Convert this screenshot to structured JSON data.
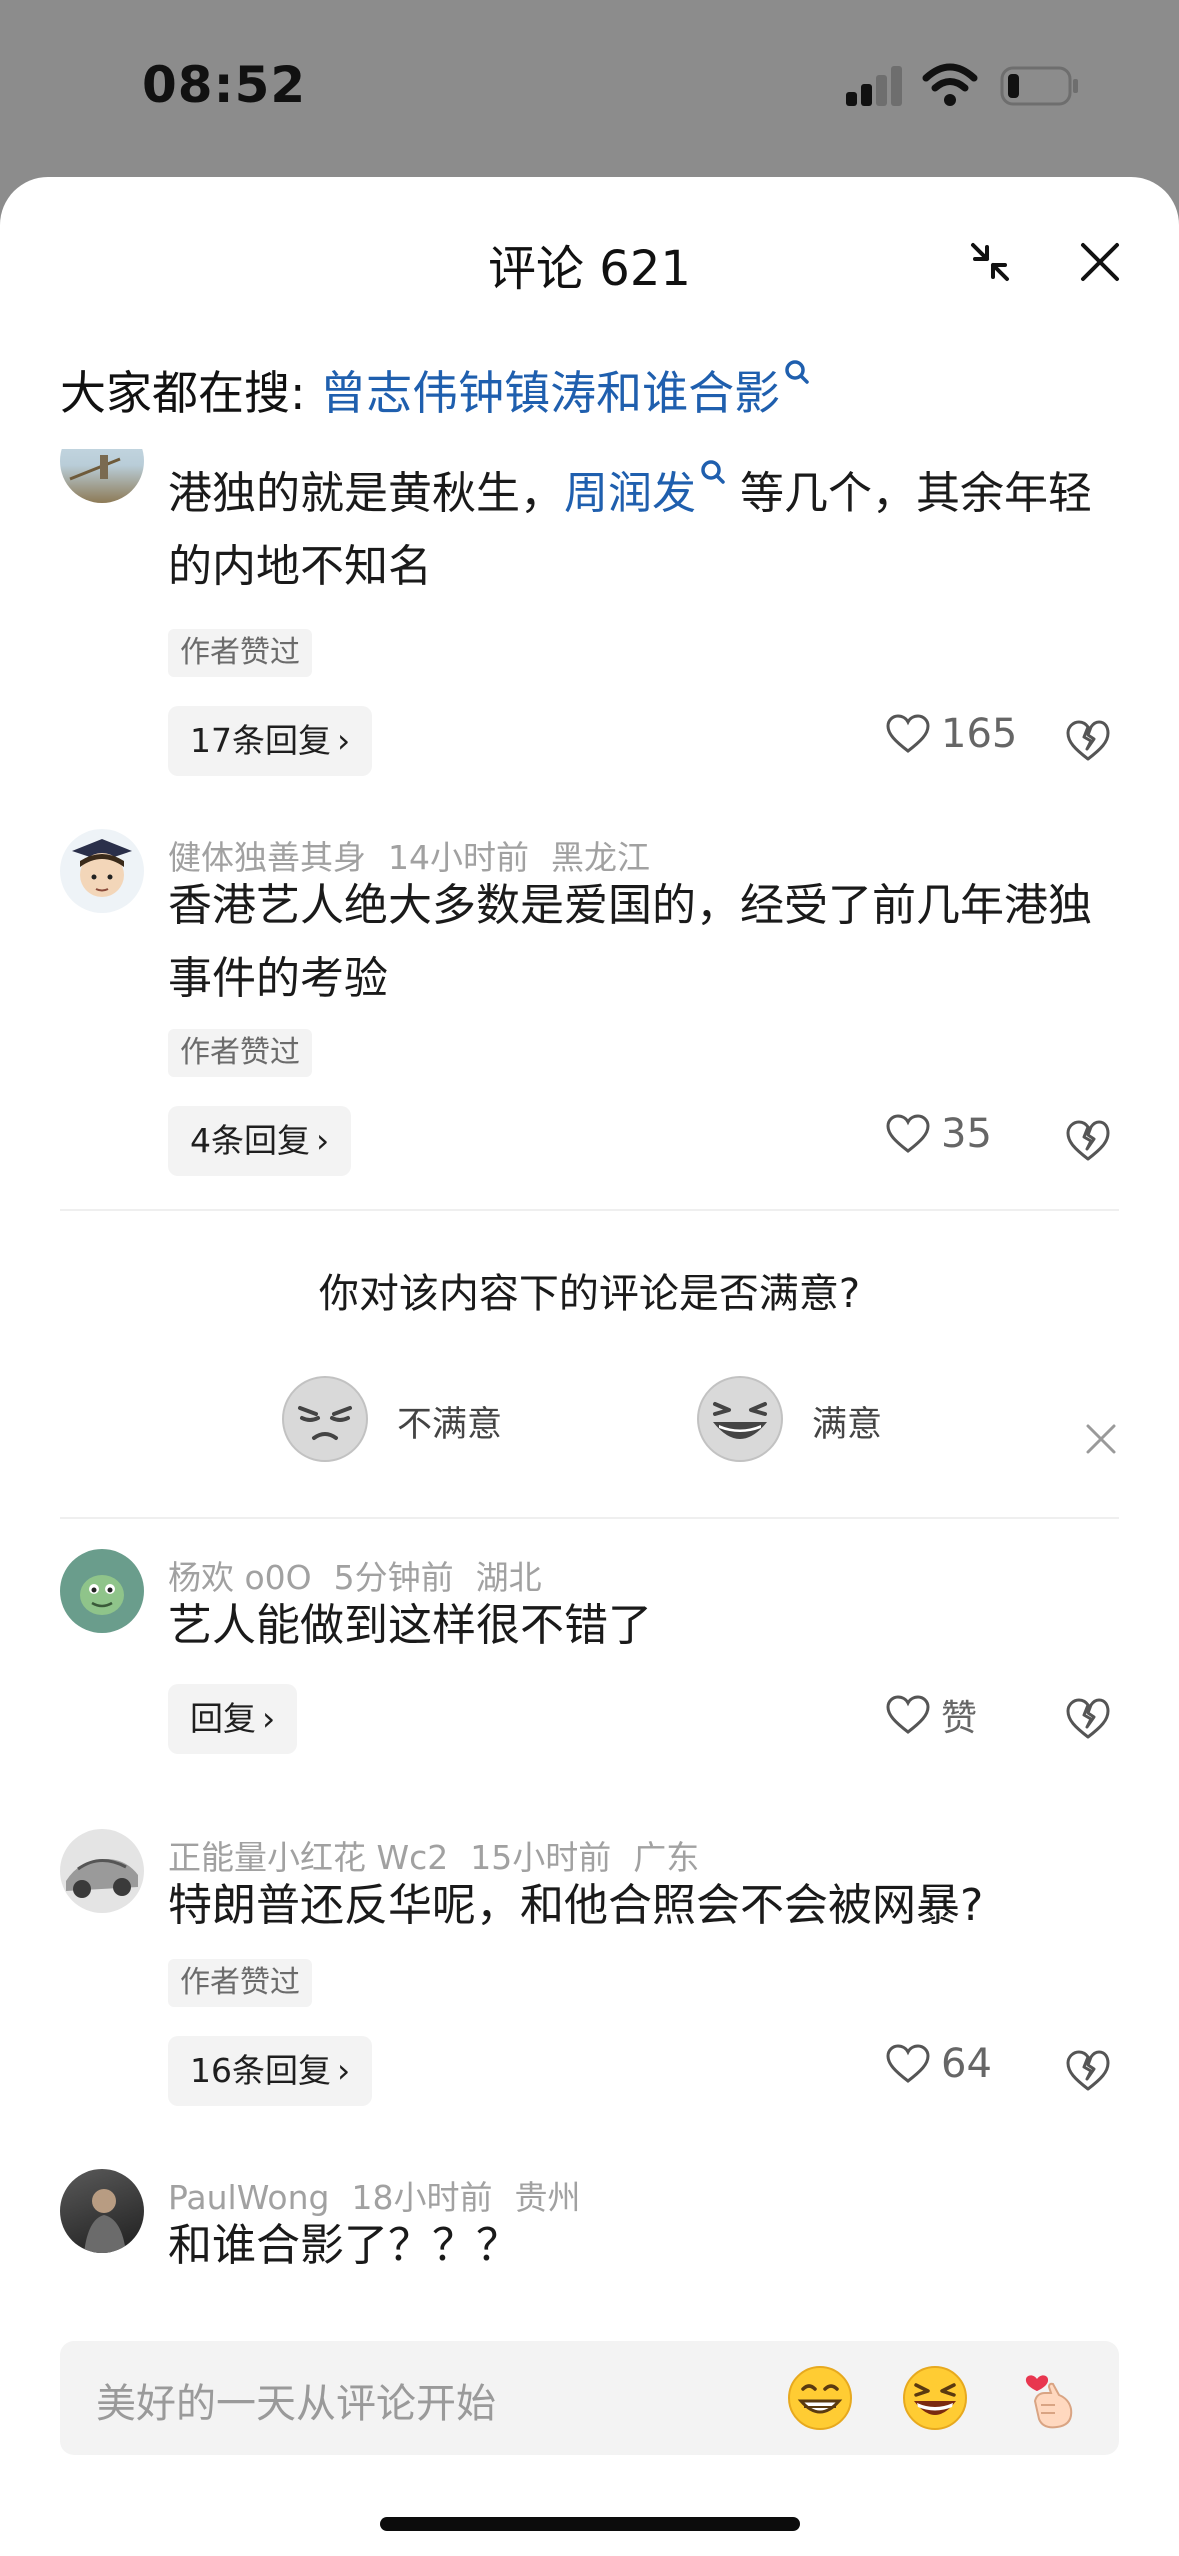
{
  "status_bar": {
    "time": "08:52"
  },
  "sheet": {
    "title": "评论 621"
  },
  "hot_search": {
    "prefix": "大家都在搜: ",
    "query": "曾志伟钟镇涛和谁合影"
  },
  "comments": [
    {
      "user": "",
      "time": "",
      "location": "",
      "text_before": "港独的就是黄秋生，",
      "text_link": "周润发",
      "text_after": " 等几个，其余年轻的内地不知名",
      "author_like": "作者赞过",
      "reply_label": "17条回复",
      "like_count": "165"
    },
    {
      "user": "健体独善其身",
      "time": "14小时前",
      "location": "黑龙江",
      "text": "香港艺人绝大多数是爱国的，经受了前几年港独事件的考验",
      "author_like": "作者赞过",
      "reply_label": "4条回复",
      "like_count": "35"
    },
    {
      "user": "杨欢 o0O",
      "time": "5分钟前",
      "location": "湖北",
      "text": "艺人能做到这样很不错了",
      "reply_label": "回复",
      "like_count": "赞"
    },
    {
      "user": "正能量小红花 Wc2",
      "time": "15小时前",
      "location": "广东",
      "text": "特朗普还反华呢，和他合照会不会被网暴?",
      "author_like": "作者赞过",
      "reply_label": "16条回复",
      "like_count": "64"
    },
    {
      "user": "PaulWong",
      "time": "18小时前",
      "location": "贵州",
      "text": "和谁合影了？？？"
    }
  ],
  "survey": {
    "question": "你对该内容下的评论是否满意?",
    "options": [
      {
        "label": "不满意",
        "icon": "unsatisfied-face-icon"
      },
      {
        "label": "满意",
        "icon": "satisfied-face-icon"
      }
    ]
  },
  "input_bar": {
    "placeholder": "美好的一天从评论开始"
  },
  "colors": {
    "link": "#1f5fae",
    "meta": "#a1a1a1",
    "pill_bg": "#f3f3f3"
  }
}
